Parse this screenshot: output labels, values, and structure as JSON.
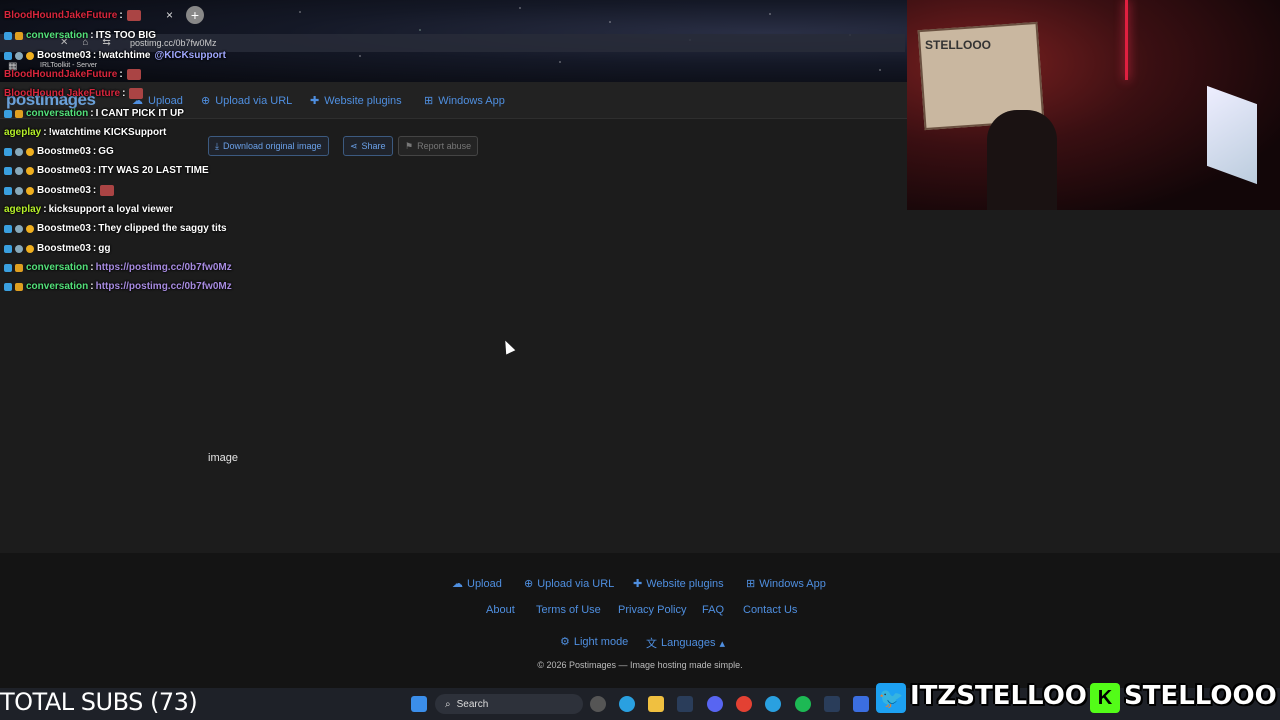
{
  "browser": {
    "url": "postimg.cc/0b7fw0Mz",
    "bookmark": "IRLToolkit - Server",
    "new_tab": "+",
    "close_tab": "×"
  },
  "site": {
    "logo": "postimages",
    "nav": [
      {
        "label": "Upload",
        "icon": "cloud-upload-icon"
      },
      {
        "label": "Upload via URL",
        "icon": "globe-icon"
      },
      {
        "label": "Website plugins",
        "icon": "puzzle-icon"
      },
      {
        "label": "Windows App",
        "icon": "windows-icon"
      }
    ],
    "actions": {
      "download": "Download original image",
      "share": "Share",
      "report": "Report abuse"
    },
    "image_alt": "image"
  },
  "footer": {
    "row1": [
      "Upload",
      "Upload via URL",
      "Website plugins",
      "Windows App"
    ],
    "row2": [
      "About",
      "Terms of Use",
      "Privacy Policy",
      "FAQ",
      "Contact Us"
    ],
    "light_mode": "Light mode",
    "languages": "Languages",
    "copyright": "© 2026 Postimages — Image hosting made simple."
  },
  "chat": [
    {
      "user": "BloodHoundJakeFuture",
      "text": "",
      "emote": true,
      "color": "red"
    },
    {
      "user": "conversation",
      "text": "ITS TOO BIG",
      "color": "green"
    },
    {
      "user": "Boostme03",
      "text": "!watchtime",
      "mention": "@KICKsupport",
      "color": "white"
    },
    {
      "user": "BloodHoundJakeFuture",
      "text": "",
      "emote": true,
      "color": "red"
    },
    {
      "user": "BloodHound JakeFuture",
      "text": "",
      "emote": true,
      "color": "red"
    },
    {
      "user": "conversation",
      "text": "I CANT PICK IT UP",
      "color": "green"
    },
    {
      "user": "ageplay",
      "text": "!watchtime KICKSupport",
      "color": "yellow"
    },
    {
      "user": "Boostme03",
      "text": "GG",
      "color": "white"
    },
    {
      "user": "Boostme03",
      "text": "ITY WAS 20 LAST TIME",
      "color": "white"
    },
    {
      "user": "Boostme03",
      "text": "",
      "emote": true,
      "color": "white"
    },
    {
      "user": "ageplay",
      "text": "kicksupport a loyal viewer",
      "color": "yellow"
    },
    {
      "user": "Boostme03",
      "text": "They clipped the saggy tits",
      "color": "white"
    },
    {
      "user": "Boostme03",
      "text": "gg",
      "color": "white"
    },
    {
      "user": "conversation",
      "text": "https://postimg.cc/0b7fw0Mz",
      "color": "green",
      "link": true
    },
    {
      "user": "conversation",
      "text": "https://postimg.cc/0b7fw0Mz",
      "color": "green",
      "link": true
    }
  ],
  "overlay": {
    "total_subs": "TOTAL SUBS (73)",
    "twitter": "ITZSTELLOO",
    "kick": "STELLOOO",
    "kick_letter": "K"
  },
  "webcam": {
    "box_text": "STELLOOO"
  },
  "taskbar": {
    "search": "Search"
  }
}
